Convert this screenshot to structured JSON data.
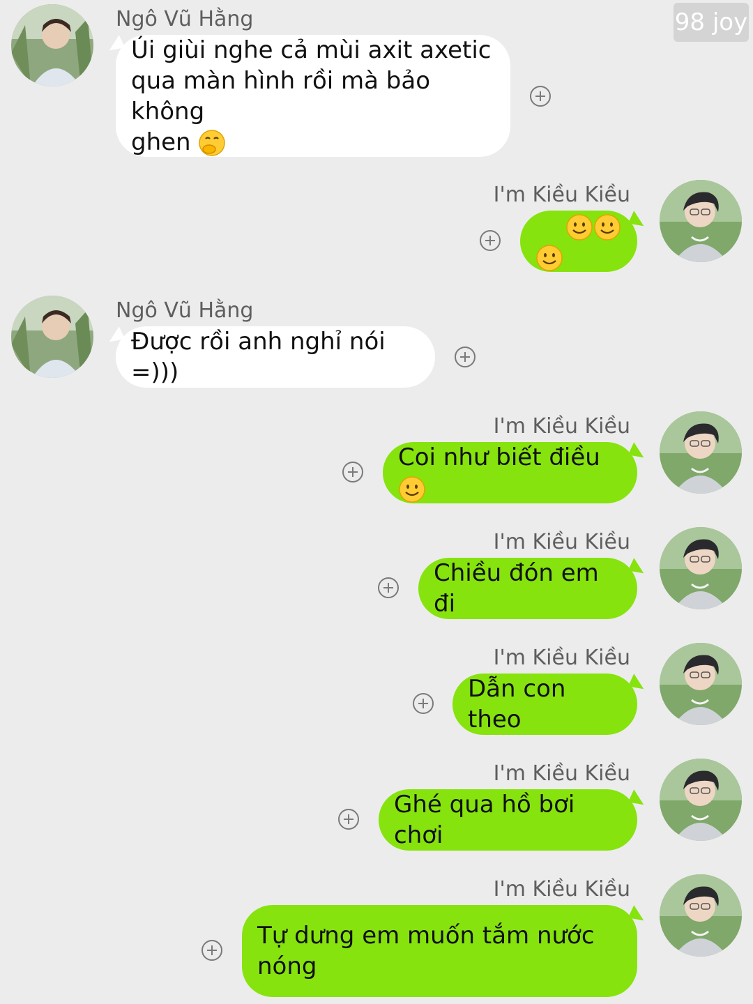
{
  "counter": "98 joy",
  "contacts": {
    "left_name": "Ngô Vũ Hằng",
    "right_name": "I'm Kiều Kiều"
  },
  "messages": [
    {
      "side": "in",
      "sender": "Ngô Vũ Hằng",
      "text": "Úi giùi nghe cả mùi axit axetic\nqua màn hình rồi mà bảo không\nghen",
      "emoji": [
        "face-with-hand-over-mouth"
      ]
    },
    {
      "side": "out",
      "sender": "I'm Kiều Kiều",
      "text": "",
      "emoji": [
        "smiling-face",
        "smiling-face",
        "smiling-face"
      ]
    },
    {
      "side": "in",
      "sender": "Ngô Vũ Hằng",
      "text": "Được rồi anh nghỉ nói =)))",
      "emoji": []
    },
    {
      "side": "out",
      "sender": "I'm Kiều Kiều",
      "text": "Coi như biết điều",
      "emoji": [
        "smiling-face"
      ]
    },
    {
      "side": "out",
      "sender": "I'm Kiều Kiều",
      "text": "Chiều đón em đi",
      "emoji": []
    },
    {
      "side": "out",
      "sender": "I'm Kiều Kiều",
      "text": "Dẫn con theo",
      "emoji": []
    },
    {
      "side": "out",
      "sender": "I'm Kiều Kiều",
      "text": "Ghé qua hồ bơi chơi",
      "emoji": []
    },
    {
      "side": "out",
      "sender": "I'm Kiều Kiều",
      "text": "Tự dưng em muốn tắm nước\nnóng",
      "emoji": []
    }
  ],
  "colors": {
    "background": "#ececec",
    "incoming_bubble": "#ffffff",
    "outgoing_bubble": "#86e30d",
    "name_text": "#5e5e5e"
  }
}
